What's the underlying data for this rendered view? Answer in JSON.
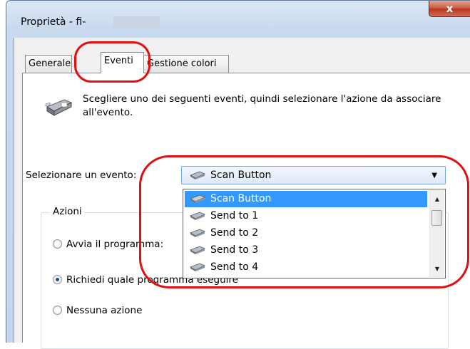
{
  "window": {
    "title": "Proprietà - fi-",
    "close_label": "x"
  },
  "tabs": [
    {
      "label": "Generale"
    },
    {
      "label": "Eventi"
    },
    {
      "label": "Gestione colori"
    }
  ],
  "description": "Scegliere uno dei seguenti eventi, quindi selezionare l'azione da associare all'evento.",
  "event_select": {
    "label": "Selezionare un evento:",
    "value": "Scan Button",
    "options": [
      "Scan Button",
      "Send to 1",
      "Send to 2",
      "Send to 3",
      "Send to 4"
    ]
  },
  "actions": {
    "group_title": "Azioni",
    "options": [
      {
        "label": "Avvia il programma:",
        "checked": false
      },
      {
        "label": "Richiedi quale programma eseguire",
        "checked": true
      },
      {
        "label": "Nessuna azione",
        "checked": false
      }
    ]
  },
  "colors": {
    "highlight": "#e01010",
    "selection": "#3399ff"
  }
}
